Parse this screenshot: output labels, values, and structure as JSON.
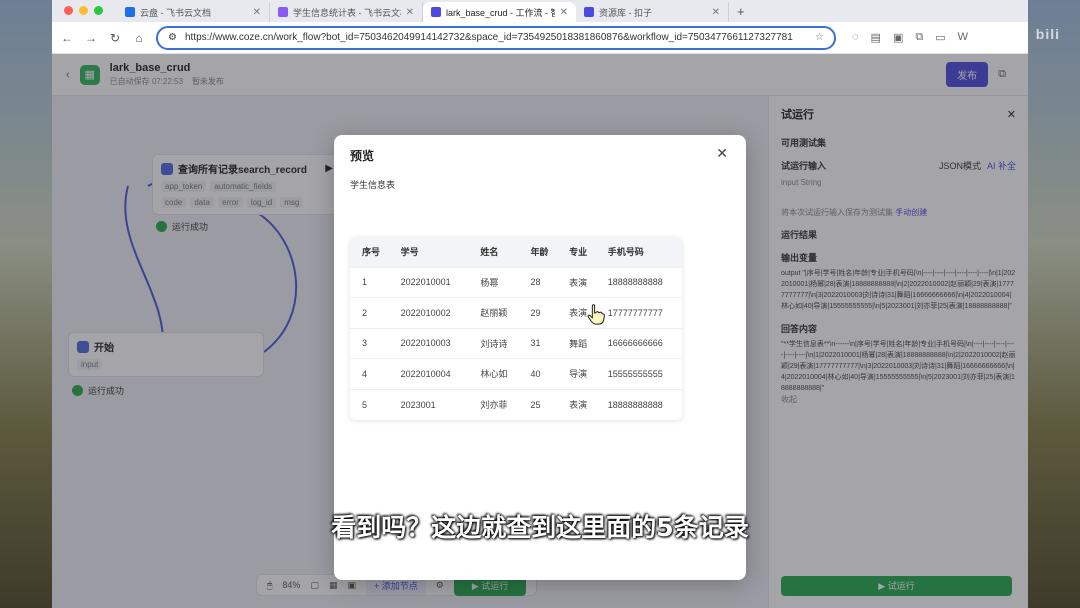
{
  "browser": {
    "tabs": [
      {
        "label": "云盘 - 飞书云文档",
        "color": "#1f6feb",
        "active": false
      },
      {
        "label": "学生信息统计表 - 飞书云文档",
        "color": "#8a5cf5",
        "active": false
      },
      {
        "label": "lark_base_crud - 工作流 - 智能",
        "color": "#4b4be0",
        "active": true
      },
      {
        "label": "资源库 - 扣子",
        "color": "#4b4be0",
        "active": false
      }
    ],
    "url": "https://www.coze.cn/work_flow?bot_id=7503462049914142732&space_id=7354925018381860876&workflow_id=7503477661127327781"
  },
  "app": {
    "name": "lark_base_crud",
    "subtitle_left": "已自动保存 07:22:53",
    "subtitle_mid": "暂未发布",
    "publish_label": "发布"
  },
  "canvas": {
    "search_node": {
      "title": "查询所有记录search_record",
      "inputs": [
        "app_token",
        "automatic_fields"
      ],
      "outputs": [
        "code",
        "data",
        "error",
        "log_id",
        "msg"
      ],
      "status": "运行成功"
    },
    "start_node": {
      "title": "开始",
      "input": "input",
      "status": "运行成功"
    },
    "toolbar": {
      "zoom": "84%",
      "add_node": "添加节点",
      "run": "试运行"
    }
  },
  "panel": {
    "title": "试运行",
    "test_set_label": "可用测试集",
    "run_input_label": "试运行输入",
    "json_mode_label": "JSON模式",
    "ai_fill_label": "AI 补全",
    "input_field": "input",
    "input_type": "String",
    "save_hint": "将本次试运行输入保存为测试集",
    "save_link": "手动创建",
    "result_label": "运行结果",
    "output_var_label": "输出变量",
    "output_code": "output \"|序号|学号|姓名|年龄|专业|手机号码|\\n|----|----|----|----|----|----|\\n|1|2022010001|杨幂|28|表演|18888888888|\\n|2|2022010002|赵丽颖|29|表演|17777777777|\\n|3|2022010003|刘诗诗|31|舞蹈|16666666666|\\n|4|2022010004|林心如|40|导演|15555555555|\\n|5|2023001|刘亦菲|25|表演|18888888888|\"",
    "answer_label": "回答内容",
    "answer_code": "\"**学生信息表**\\n------\\n|序号|学号|姓名|年龄|专业|手机号码|\\n|----|----|----|----|----|----|\\n|1|2022010001|杨幂|28|表演|18888888888|\\n|2|2022010002|赵丽颖|29|表演|17777777777|\\n|3|2022010003|刘诗诗|31|舞蹈|16666666666|\\n|4|2022010004|林心如|40|导演|15555555555|\\n|5|2023001|刘亦菲|25|表演|18888888888|\"",
    "collapse_label": "收起",
    "run_button": "试运行"
  },
  "modal": {
    "title": "预览",
    "subtitle": "学生信息表",
    "headers": [
      "序号",
      "学号",
      "姓名",
      "年龄",
      "专业",
      "手机号码"
    ],
    "rows": [
      [
        "1",
        "2022010001",
        "杨幂",
        "28",
        "表演",
        "18888888888"
      ],
      [
        "2",
        "2022010002",
        "赵丽颖",
        "29",
        "表演",
        "17777777777"
      ],
      [
        "3",
        "2022010003",
        "刘诗诗",
        "31",
        "舞蹈",
        "16666666666"
      ],
      [
        "4",
        "2022010004",
        "林心如",
        "40",
        "导演",
        "15555555555"
      ],
      [
        "5",
        "2023001",
        "刘亦菲",
        "25",
        "表演",
        "18888888888"
      ]
    ]
  },
  "subtitle": "看到吗？这边就查到这里面的5条记录"
}
